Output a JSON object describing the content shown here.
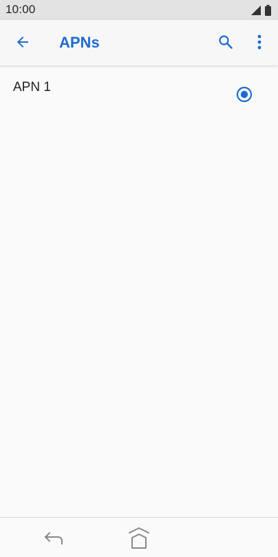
{
  "status_bar": {
    "time": "10:00",
    "icons": [
      "cell-signal-icon",
      "battery-icon"
    ]
  },
  "app_bar": {
    "title": "APNs",
    "back_icon": "arrow-back-icon",
    "search_icon": "search-icon",
    "more_icon": "more-vert-icon"
  },
  "apn_list": [
    {
      "label": "APN 1",
      "selected": true
    }
  ],
  "nav_bar": {
    "icons": [
      "nav-back-icon",
      "nav-home-icon"
    ]
  },
  "colors": {
    "accent": "#1e6bd0",
    "status_bar_bg": "#e3e3e3",
    "app_bar_bg": "#f7f7f7",
    "background": "#fafafa",
    "text": "#222222"
  }
}
